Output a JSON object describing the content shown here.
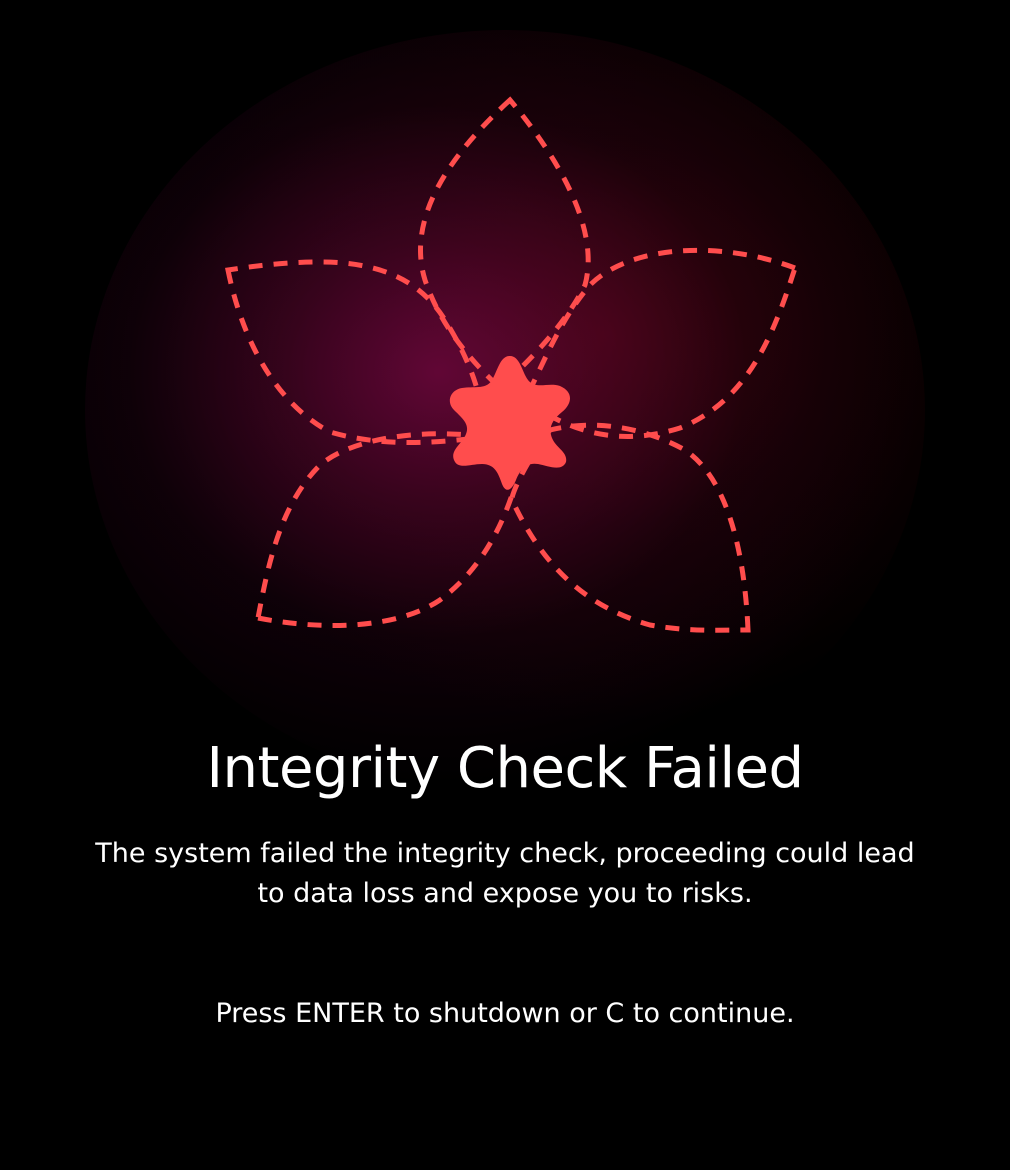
{
  "screen": {
    "title": "Integrity Check Failed",
    "description": "The system failed the integrity check, proceeding could lead to data loss and expose you to risks.",
    "prompt": "Press ENTER to shutdown or C to continue."
  },
  "emblem": {
    "icon": "dashed-flower-warning-icon",
    "accent_color": "#ff4d4d",
    "background_color": "#000000",
    "glow_colors": [
      "#78084a",
      "#6e060c"
    ]
  }
}
